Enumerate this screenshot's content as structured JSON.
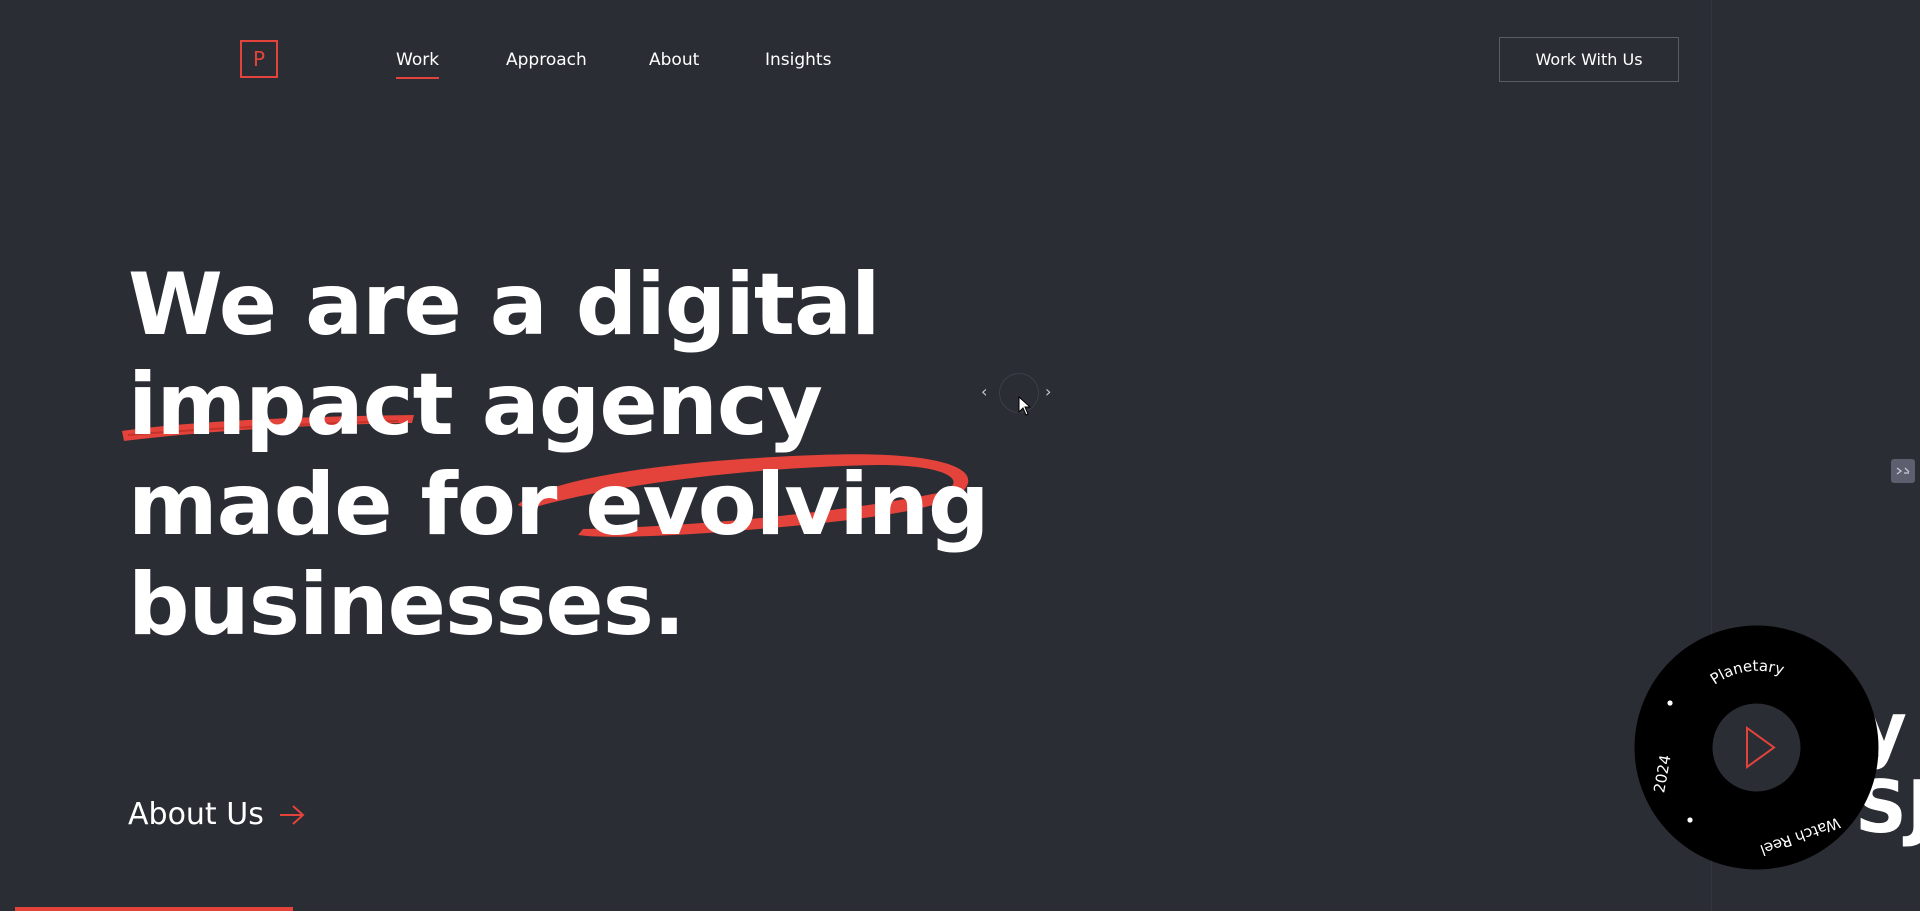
{
  "logo": {
    "letter": "P"
  },
  "nav": {
    "items": [
      {
        "label": "Work",
        "active": true
      },
      {
        "label": "Approach",
        "active": false
      },
      {
        "label": "About",
        "active": false
      },
      {
        "label": "Insights",
        "active": false
      }
    ],
    "cta_label": "Work With Us"
  },
  "hero": {
    "line1": "We are a digital",
    "line2_a": "impact",
    "line2_b": " agency",
    "line3_a": "made for ",
    "line3_b": "evolving",
    "line4": "businesses."
  },
  "slider": {
    "prev_icon": "‹",
    "next_icon": "›"
  },
  "about_link": {
    "label": "About Us"
  },
  "peek_text": {
    "line1": "y",
    "line2": "SJ"
  },
  "reel": {
    "top_text": "Planetary",
    "left_text": "2024",
    "bottom_text": "Watch Reel"
  },
  "colors": {
    "accent": "#e3433a",
    "background": "#2a2d34",
    "reel_bg": "#000000"
  }
}
